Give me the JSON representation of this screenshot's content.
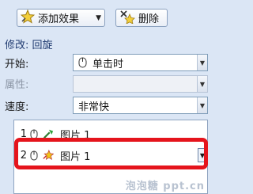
{
  "toolbar": {
    "add_effect_label": "添加效果",
    "remove_label": "删除"
  },
  "modify": {
    "title": "修改: 回旋"
  },
  "fields": {
    "start_label": "开始:",
    "start_value": "单击时",
    "property_label": "属性:",
    "property_value": "",
    "speed_label": "速度:",
    "speed_value": "非常快"
  },
  "animation_list": [
    {
      "number": "1",
      "label": "图片 1"
    },
    {
      "number": "2",
      "label": "图片 1"
    }
  ],
  "watermark": "泡泡糖 ppt.cn",
  "colors": {
    "panel_bg": "#dbe6f5",
    "highlight": "#e5141c"
  }
}
